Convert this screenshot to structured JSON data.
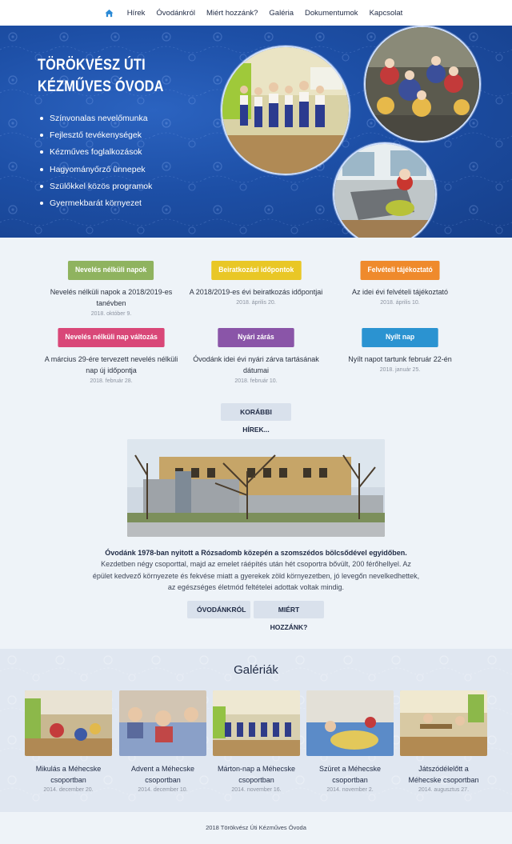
{
  "nav": {
    "items": [
      "Hírek",
      "Óvodánkról",
      "Miért hozzánk?",
      "Galéria",
      "Dokumentumok",
      "Kapcsolat"
    ],
    "home_icon": "home-icon"
  },
  "hero": {
    "title_line1": "TÖRÖKVÉSZ ÚTI",
    "title_line2": "KÉZMŰVES ÓVODA",
    "bullets": [
      "Színvonalas nevelőmunka",
      "Fejlesztő tevékenységek",
      "Kézműves foglalkozások",
      "Hagyományőrző ünnepek",
      "Szülőkkel közös programok",
      "Gyermekbarát környezet"
    ]
  },
  "news": [
    {
      "tag": "Nevelés nélküli napok",
      "desc": "Nevelés nélküli napok a 2018/2019-es tanévben",
      "date": "2018. október 9.",
      "color": "#8fb35f"
    },
    {
      "tag": "Beiratkozási időpontok",
      "desc": "A 2018/2019-es évi beiratkozás időpontjai",
      "date": "2018. április 20.",
      "color": "#e9c726"
    },
    {
      "tag": "Felvételi tájékoztató",
      "desc": "Az idei évi felvételi tájékoztató",
      "date": "2018. április 10.",
      "color": "#ef8a2c"
    },
    {
      "tag": "Nevelés nélküli nap változás",
      "desc": "A március 29-ére tervezett nevelés nélküli nap új időpontja",
      "date": "2018. február 28.",
      "color": "#d94778"
    },
    {
      "tag": "Nyári zárás",
      "desc": "Óvodánk idei évi nyári zárva tartásának dátumai",
      "date": "2018. február 10.",
      "color": "#8a55a8"
    },
    {
      "tag": "Nyílt nap",
      "desc": "Nyílt napot tartunk február 22-én",
      "date": "2018. január 25.",
      "color": "#2b93d1"
    }
  ],
  "more_news": "KORÁBBI HÍREK...",
  "about": {
    "lead": "Óvodánk 1978-ban nyitott a Rózsadomb közepén a szomszédos bölcsődével egyidőben.",
    "line2": "Kezdetben négy csoporttal, majd az emelet ráépítés után hét csoportra bővült, 200 férőhellyel. Az",
    "line3": "épület kedvező környezete és fekvése miatt a gyerekek zöld környezetben, jó levegőn nevelkedhettek,",
    "line4": "az egészséges életmód feltételei adottak voltak mindig.",
    "btn1": "ÓVODÁNKRÓL",
    "btn2": "MIÉRT HOZZÁNK?"
  },
  "gallery": {
    "title": "Galériák",
    "items": [
      {
        "t1": "Mikulás a Méhecske",
        "t2": "csoportban",
        "date": "2014. december 20."
      },
      {
        "t1": "Advent a Méhecske",
        "t2": "csoportban",
        "date": "2014. december 10."
      },
      {
        "t1": "Márton-nap a Méhecske",
        "t2": "csoportban",
        "date": "2014. november 16."
      },
      {
        "t1": "Szüret a Méhecske",
        "t2": "csoportban",
        "date": "2014. november 2."
      },
      {
        "t1": "Játszódélelőtt a",
        "t2": "Méhecske csoportban",
        "date": "2014. augusztus 27."
      }
    ]
  },
  "footer": "2018 Törökvész Úti Kézműves Óvoda"
}
